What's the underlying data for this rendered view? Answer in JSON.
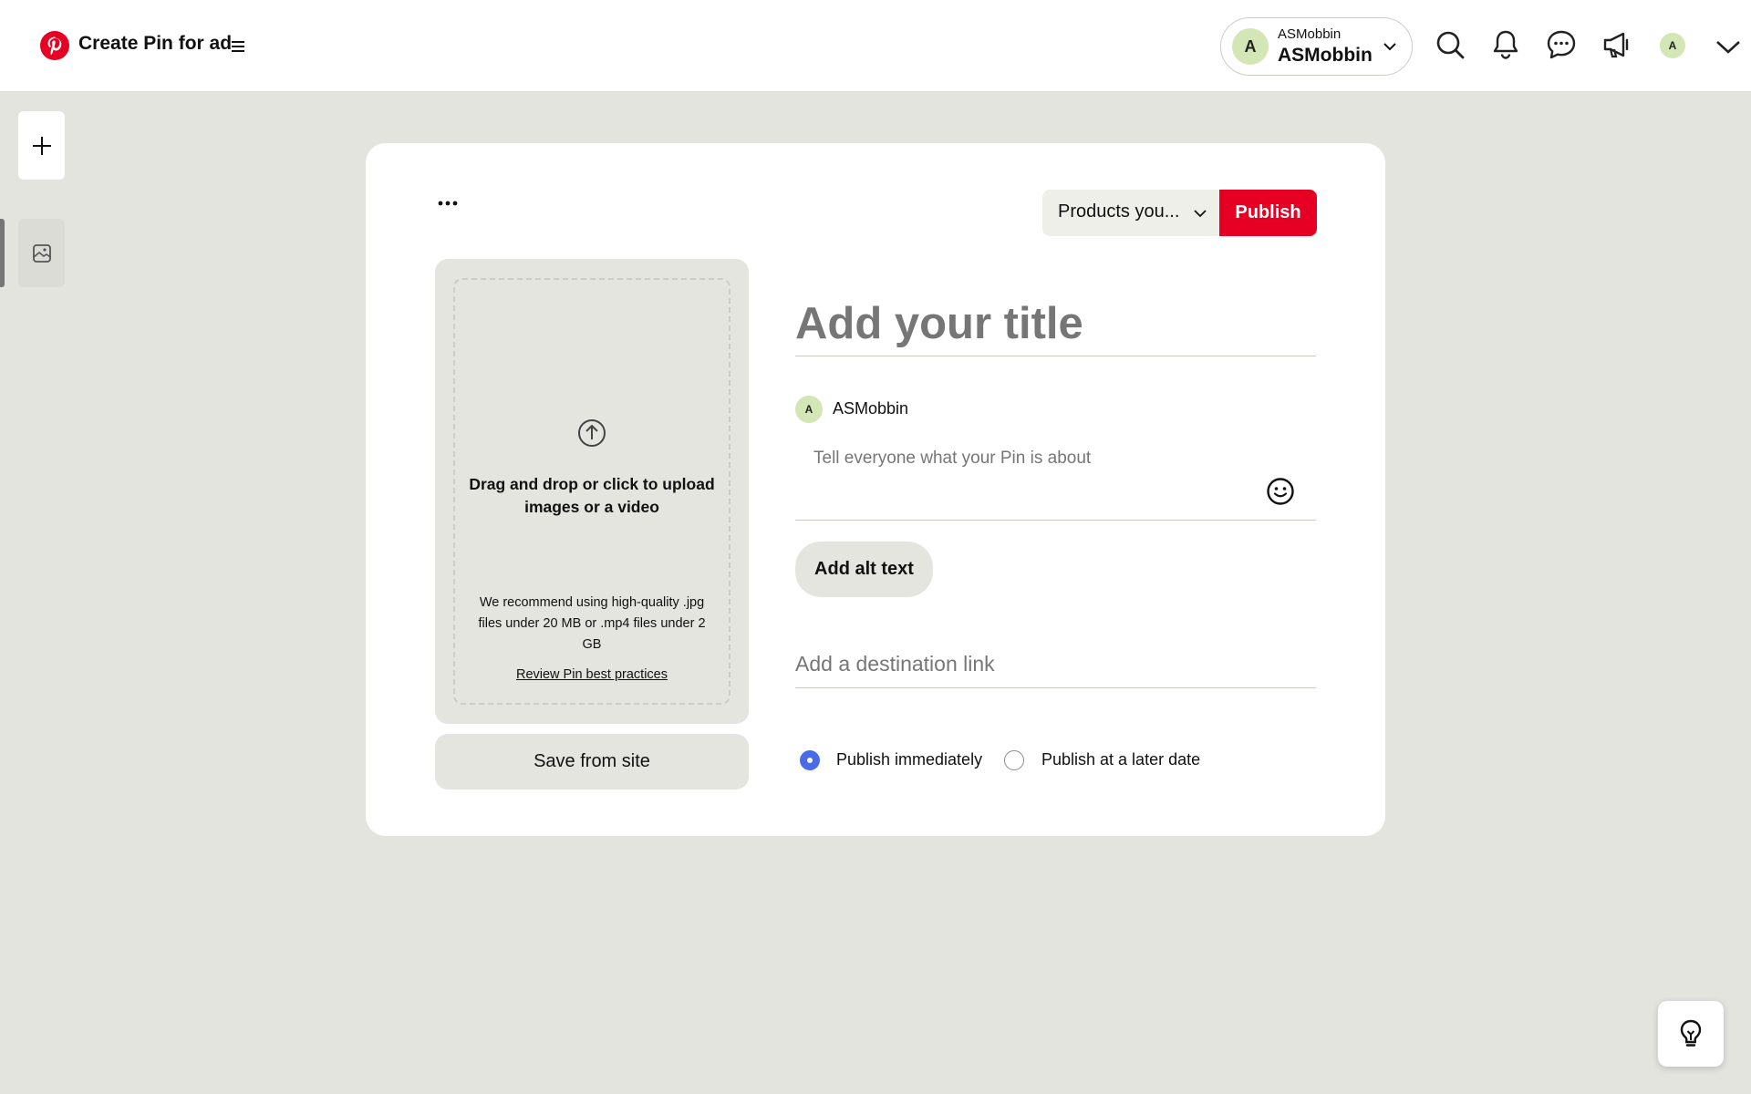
{
  "header": {
    "app_title": "Create Pin for ad",
    "account": {
      "name_small": "ASMobbin",
      "name_big": "ASMobbin",
      "avatar_letter": "A"
    },
    "user_avatar_letter": "A",
    "brand_color": "#e60023",
    "icons": [
      "pinterest-logo-icon",
      "menu-icon",
      "chevron-down-icon",
      "search-icon",
      "bell-icon",
      "chat-icon",
      "megaphone-icon",
      "chevron-down-icon"
    ]
  },
  "rail": {
    "icons": [
      "plus-icon",
      "image-icon"
    ]
  },
  "editor": {
    "board_select_value": "Products you...",
    "publish_label": "Publish",
    "upload": {
      "main_text": "Drag and drop or click to upload images or a video",
      "recommendation": "We recommend using high-quality .jpg files under 20 MB or .mp4 files under 2 GB",
      "best_practices_link": "Review Pin best practices"
    },
    "save_from_site_label": "Save from site",
    "title_placeholder": "Add your title",
    "author": {
      "avatar_letter": "A",
      "name": "ASMobbin"
    },
    "description_placeholder": "Tell everyone what your Pin is about",
    "alt_text_label": "Add alt text",
    "link_placeholder": "Add a destination link",
    "publish_options": [
      {
        "label": "Publish immediately",
        "selected": true
      },
      {
        "label": "Publish at a later date",
        "selected": false
      }
    ],
    "radio_accent": "#4a6be8"
  },
  "help": {
    "icon": "lightbulb-icon"
  }
}
